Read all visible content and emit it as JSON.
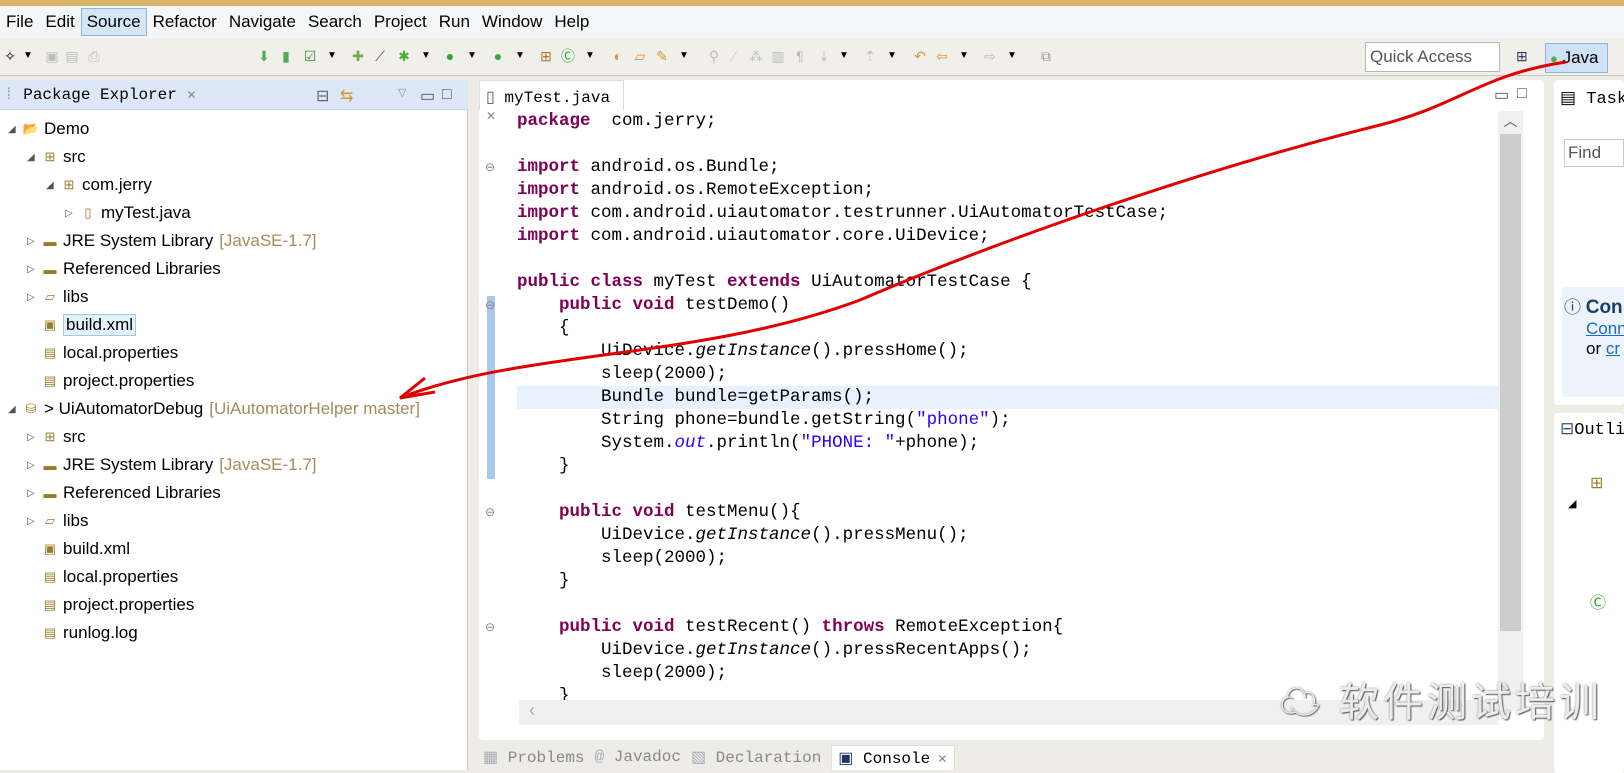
{
  "menu": [
    "File",
    "Edit",
    "Source",
    "Refactor",
    "Navigate",
    "Search",
    "Project",
    "Run",
    "Window",
    "Help"
  ],
  "active_menu": "Source",
  "toolbar": {
    "quick_access_placeholder": "Quick Access",
    "perspective": "Java"
  },
  "package_explorer": {
    "title": "Package Explorer",
    "tree": [
      {
        "label": "Demo",
        "level": 0,
        "twisty": "open",
        "icon": "folder-project-icon"
      },
      {
        "label": "src",
        "level": 1,
        "twisty": "open",
        "icon": "source-folder-icon"
      },
      {
        "label": "com.jerry",
        "level": 2,
        "twisty": "open",
        "icon": "package-icon"
      },
      {
        "label": "myTest.java",
        "level": 3,
        "twisty": "closed",
        "icon": "java-file-icon"
      },
      {
        "label": "JRE System Library",
        "deco": "[JavaSE-1.7]",
        "level": 1,
        "twisty": "closed",
        "icon": "library-icon"
      },
      {
        "label": "Referenced Libraries",
        "level": 1,
        "twisty": "closed",
        "icon": "library-icon"
      },
      {
        "label": "libs",
        "level": 1,
        "twisty": "closed",
        "icon": "folder-icon"
      },
      {
        "label": "build.xml",
        "level": 1,
        "twisty": "",
        "icon": "xml-file-icon",
        "selected": true
      },
      {
        "label": "local.properties",
        "level": 1,
        "twisty": "",
        "icon": "file-icon"
      },
      {
        "label": "project.properties",
        "level": 1,
        "twisty": "",
        "icon": "file-icon"
      },
      {
        "label": "> UiAutomatorDebug",
        "deco": "[UiAutomatorHelper master]",
        "level": 0,
        "twisty": "open",
        "icon": "git-project-icon"
      },
      {
        "label": "src",
        "level": 1,
        "twisty": "closed",
        "icon": "source-folder-icon"
      },
      {
        "label": "JRE System Library",
        "deco": "[JavaSE-1.7]",
        "level": 1,
        "twisty": "closed",
        "icon": "library-icon"
      },
      {
        "label": "Referenced Libraries",
        "level": 1,
        "twisty": "closed",
        "icon": "library-icon"
      },
      {
        "label": "libs",
        "level": 1,
        "twisty": "closed",
        "icon": "folder-icon"
      },
      {
        "label": "build.xml",
        "level": 1,
        "twisty": "",
        "icon": "xml-file-icon"
      },
      {
        "label": "local.properties",
        "level": 1,
        "twisty": "",
        "icon": "file-icon"
      },
      {
        "label": "project.properties",
        "level": 1,
        "twisty": "",
        "icon": "file-icon"
      },
      {
        "label": "runlog.log",
        "level": 1,
        "twisty": "",
        "icon": "file-icon"
      }
    ]
  },
  "editor": {
    "tab": "myTest.java",
    "lines": [
      [
        [
          "kw",
          "package"
        ],
        [
          "",
          "  com.jerry;"
        ]
      ],
      [],
      [
        [
          "kw",
          "import"
        ],
        [
          "",
          " android.os.Bundle;"
        ]
      ],
      [
        [
          "kw",
          "import"
        ],
        [
          "",
          " android.os.RemoteException;"
        ]
      ],
      [
        [
          "kw",
          "import"
        ],
        [
          "",
          " com.android.uiautomator.testrunner.UiAutomatorTestCase;"
        ]
      ],
      [
        [
          "kw",
          "import"
        ],
        [
          "",
          " com.android.uiautomator.core.UiDevice;"
        ]
      ],
      [],
      [
        [
          "kw",
          "public class"
        ],
        [
          "",
          " myTest "
        ],
        [
          "kw",
          "extends"
        ],
        [
          "",
          " UiAutomatorTestCase {"
        ]
      ],
      [
        [
          "",
          "    "
        ],
        [
          "kw",
          "public void"
        ],
        [
          "",
          " testDemo()"
        ]
      ],
      [
        [
          "",
          "    {"
        ]
      ],
      [
        [
          "",
          "        UiDevice."
        ],
        [
          "it",
          "getInstance"
        ],
        [
          "",
          "().pressHome();"
        ]
      ],
      [
        [
          "",
          "        sleep(2000);"
        ]
      ],
      [
        [
          "",
          "        Bundle bundle=getParams();"
        ]
      ],
      [
        [
          "",
          "        String phone=bundle.getString("
        ],
        [
          "str",
          "\"phone\""
        ],
        [
          "",
          ");"
        ]
      ],
      [
        [
          "",
          "        System."
        ],
        [
          "it str",
          "out"
        ],
        [
          "",
          ".println("
        ],
        [
          "str",
          "\"PHONE: \""
        ],
        [
          "",
          "+phone);"
        ]
      ],
      [
        [
          "",
          "    }"
        ]
      ],
      [],
      [
        [
          "",
          "    "
        ],
        [
          "kw",
          "public void"
        ],
        [
          "",
          " testMenu(){"
        ]
      ],
      [
        [
          "",
          "        UiDevice."
        ],
        [
          "it",
          "getInstance"
        ],
        [
          "",
          "().pressMenu();"
        ]
      ],
      [
        [
          "",
          "        sleep(2000);"
        ]
      ],
      [
        [
          "",
          "    }"
        ]
      ],
      [],
      [
        [
          "",
          "    "
        ],
        [
          "kw",
          "public void"
        ],
        [
          "",
          " testRecent() "
        ],
        [
          "kw",
          "throws"
        ],
        [
          "",
          " RemoteException{"
        ]
      ],
      [
        [
          "",
          "        UiDevice."
        ],
        [
          "it",
          "getInstance"
        ],
        [
          "",
          "().pressRecentApps();"
        ]
      ],
      [
        [
          "",
          "        sleep(2000);"
        ]
      ],
      [
        [
          "",
          "    }"
        ]
      ]
    ],
    "highlighted_line": 12,
    "fold_lines": [
      2,
      8,
      17,
      22
    ]
  },
  "right": {
    "task_title": "Task",
    "find_placeholder": "Find",
    "connect_title": "Con",
    "connect_link": "Conn",
    "or_text": "or",
    "create_link": "cr",
    "outline_title": "Outli"
  },
  "bottom_tabs": [
    "Problems",
    "Javadoc",
    "Declaration",
    "Console"
  ],
  "active_bottom_tab": "Console",
  "watermark": "软件测试培训",
  "annotation_color": "#e00000"
}
